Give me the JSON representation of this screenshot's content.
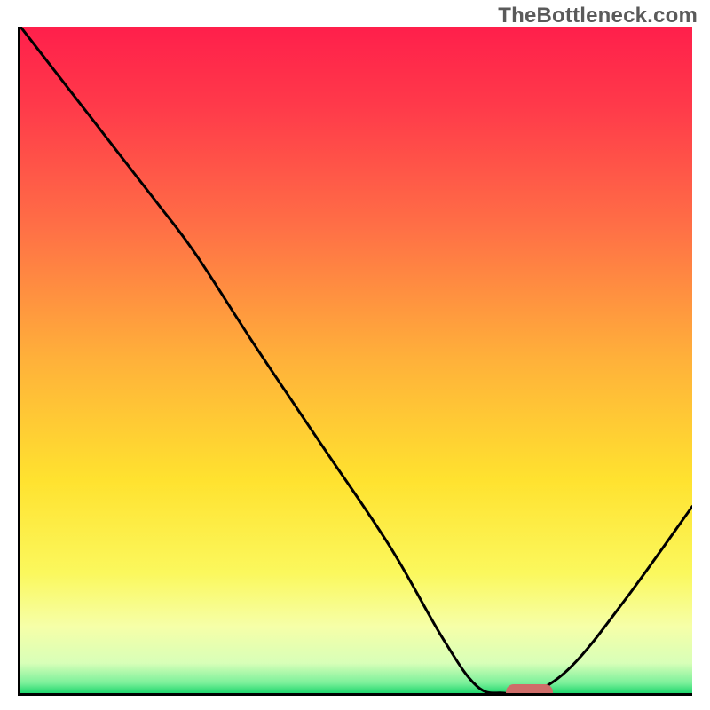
{
  "watermark": "TheBottleneck.com",
  "chart_data": {
    "type": "line",
    "title": "",
    "xlabel": "",
    "ylabel": "",
    "xlim": [
      0,
      100
    ],
    "ylim": [
      0,
      100
    ],
    "x": [
      0,
      10,
      20,
      26,
      35,
      45,
      55,
      63,
      68,
      72,
      76,
      82,
      90,
      100
    ],
    "values": [
      100,
      87,
      74,
      66,
      52,
      37,
      22,
      8,
      1,
      0,
      0,
      4,
      14,
      28
    ],
    "marker": {
      "x_start": 72,
      "x_end": 79,
      "y": 0
    },
    "gradient_stops": [
      {
        "pos": 0.0,
        "color": "#ff1f4b"
      },
      {
        "pos": 0.12,
        "color": "#ff3a4a"
      },
      {
        "pos": 0.3,
        "color": "#ff6f46"
      },
      {
        "pos": 0.5,
        "color": "#ffb13a"
      },
      {
        "pos": 0.68,
        "color": "#ffe22f"
      },
      {
        "pos": 0.82,
        "color": "#fbf85d"
      },
      {
        "pos": 0.9,
        "color": "#f6ffa8"
      },
      {
        "pos": 0.955,
        "color": "#d8ffb8"
      },
      {
        "pos": 0.985,
        "color": "#7af09a"
      },
      {
        "pos": 1.0,
        "color": "#1fd66d"
      }
    ]
  }
}
